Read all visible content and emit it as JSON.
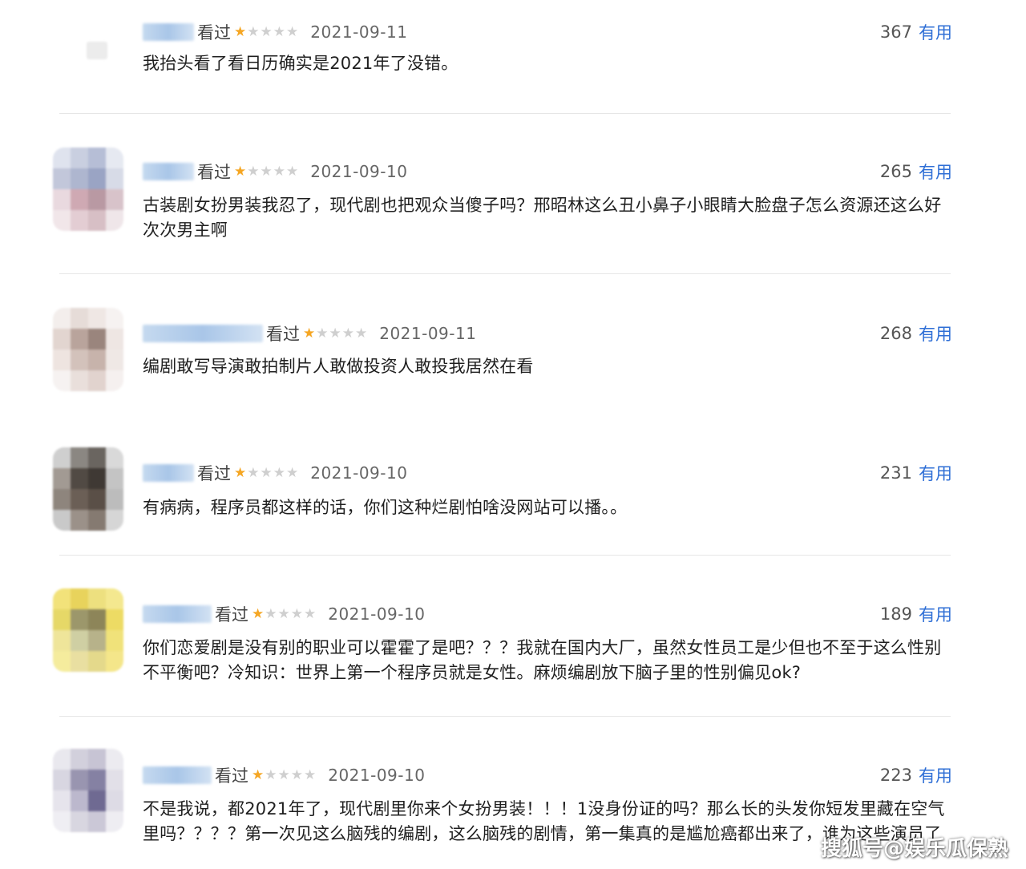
{
  "reviews": [
    {
      "watched": "看过",
      "stars": "★☆☆☆☆",
      "date": "2021-09-11",
      "useful_count": "367",
      "useful_label": "有用",
      "content": "我抬头看了看日历确实是2021年了没错。"
    },
    {
      "watched": "看过",
      "stars": "★☆☆☆☆",
      "date": "2021-09-10",
      "useful_count": "265",
      "useful_label": "有用",
      "content": "古装剧女扮男装我忍了，现代剧也把观众当傻子吗？邢昭林这么丑小鼻子小眼睛大脸盘子怎么资源还这么好次次男主啊"
    },
    {
      "watched": "看过",
      "stars": "★☆☆☆☆",
      "date": "2021-09-11",
      "useful_count": "268",
      "useful_label": "有用",
      "content": "编剧敢写导演敢拍制片人敢做投资人敢投我居然在看"
    },
    {
      "watched": "看过",
      "stars": "★☆☆☆☆",
      "date": "2021-09-10",
      "useful_count": "231",
      "useful_label": "有用",
      "content": "有病病，程序员都这样的话，你们这种烂剧怕啥没网站可以播。。"
    },
    {
      "watched": "看过",
      "stars": "★☆☆☆☆",
      "date": "2021-09-10",
      "useful_count": "189",
      "useful_label": "有用",
      "content": "你们恋爱剧是没有别的职业可以霍霍了是吧？？？我就在国内大厂，虽然女性员工是少但也不至于这么性别不平衡吧？冷知识：世界上第一个程序员就是女性。麻烦编剧放下脑子里的性别偏见ok?"
    },
    {
      "watched": "看过",
      "stars": "★☆☆☆☆",
      "date": "2021-09-10",
      "useful_count": "223",
      "useful_label": "有用",
      "content": "不是我说，都2021年了，现代剧里你来个女扮男装！！！1没身份证的吗？那么长的头发你短发里藏在空气里吗？？？？第一次见这么脑残的编剧，这么脑残的剧情，第一集真的是尴尬癌都出来了，谁为这些演员了"
    }
  ],
  "watermark": "搜狐号@娱乐瓜保熟",
  "colors": {
    "star_on": "#f5a623",
    "star_off": "#cfcfcf",
    "useful_link": "#2f6fd6",
    "username_blur": "#a9c6e8"
  }
}
